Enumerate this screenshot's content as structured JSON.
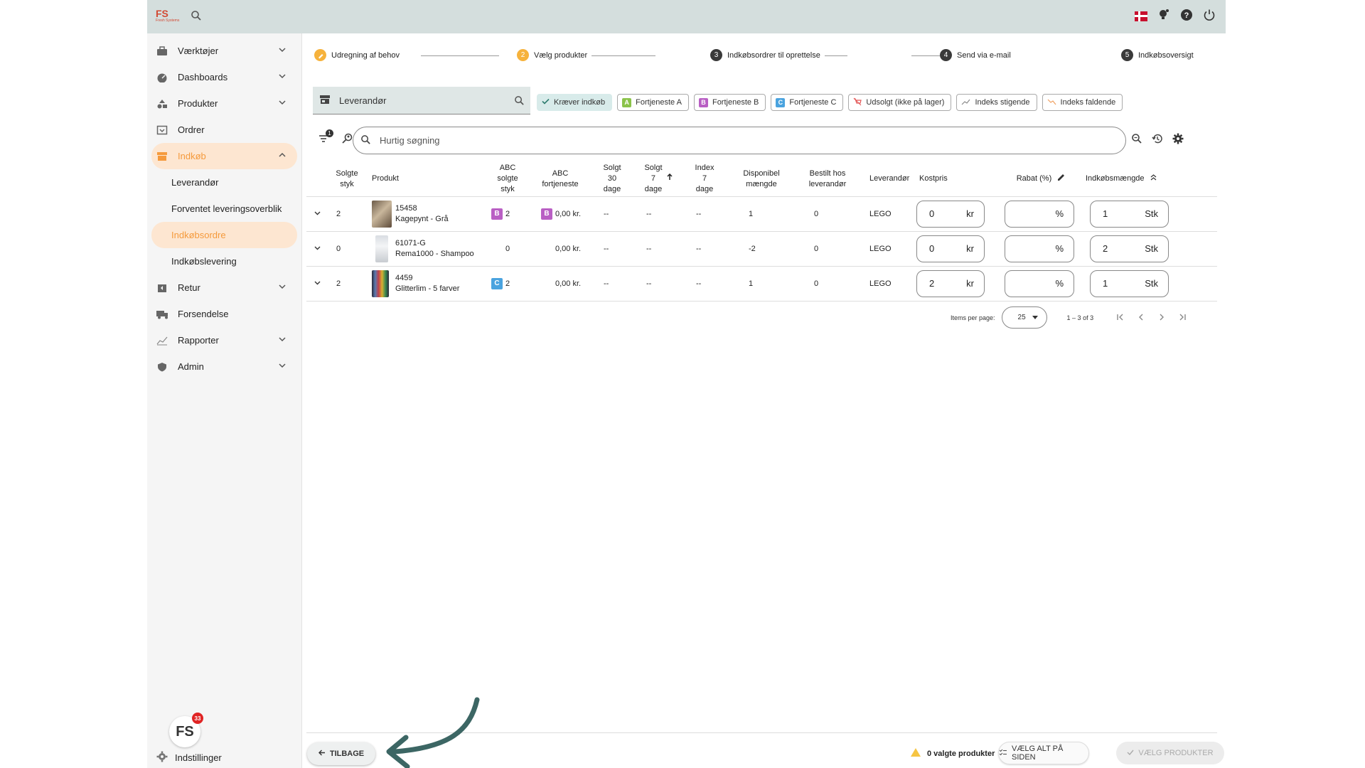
{
  "topbar": {
    "logo_mark": "FS",
    "logo_sub": "Fresh Systems",
    "icons": [
      "search-icon",
      "danish-flag-icon",
      "lightbulb-icon",
      "help-icon",
      "power-icon"
    ]
  },
  "sidebar": {
    "items": [
      {
        "label": "Værktøjer",
        "icon": "toolbox-icon",
        "chevron": "down"
      },
      {
        "label": "Dashboards",
        "icon": "dashboard-icon",
        "chevron": "down"
      },
      {
        "label": "Produkter",
        "icon": "shapes-icon",
        "chevron": "down"
      },
      {
        "label": "Ordrer",
        "icon": "order-icon"
      },
      {
        "label": "Indkøb",
        "icon": "store-icon",
        "chevron": "up",
        "active": true
      },
      {
        "label": "Retur",
        "icon": "return-icon",
        "chevron": "down"
      },
      {
        "label": "Forsendelse",
        "icon": "truck-icon"
      },
      {
        "label": "Rapporter",
        "icon": "chart-icon",
        "chevron": "down"
      },
      {
        "label": "Admin",
        "icon": "admin-icon",
        "chevron": "down"
      }
    ],
    "sub_items": [
      "Leverandør",
      "Forventet leveringsoverblik",
      "Indkøbsordre",
      "Indkøbslevering"
    ],
    "active_sub": "Indkøbsordre",
    "badge_count": "33",
    "settings_label": "Indstillinger",
    "logo_mark": "FS"
  },
  "stepper": {
    "steps": [
      {
        "n": "✓",
        "label": "Udregning af behov",
        "state": "done"
      },
      {
        "n": "2",
        "label": "Vælg produkter",
        "state": "current"
      },
      {
        "n": "3",
        "label": "Indkøbsordrer til oprettelse",
        "state": "todo"
      },
      {
        "n": "4",
        "label": "Send via e-mail",
        "state": "todo"
      },
      {
        "n": "5",
        "label": "Indkøbsoversigt",
        "state": "todo"
      }
    ]
  },
  "supplier": {
    "label": "Leverandør"
  },
  "chips": [
    {
      "label": "Kræver indkøb",
      "icon": "check-icon",
      "selected": true
    },
    {
      "label": "Fortjeneste A",
      "letter": "A",
      "color": "#8bc34a"
    },
    {
      "label": "Fortjeneste B",
      "letter": "B",
      "color": "#b95fc4"
    },
    {
      "label": "Fortjeneste C",
      "letter": "C",
      "color": "#4aa3df"
    },
    {
      "label": "Udsolgt (ikke på lager)",
      "icon": "cart-off-icon"
    },
    {
      "label": "Indeks stigende",
      "icon": "trend-up-icon"
    },
    {
      "label": "Indeks faldende",
      "icon": "trend-down-icon"
    }
  ],
  "filter_badge": "1",
  "search": {
    "placeholder": "Hurtig søgning"
  },
  "table": {
    "headers": [
      "Solgte\nstyk",
      "Produkt",
      "ABC\nsolgte\nstyk",
      "ABC\nfortjeneste",
      "Solgt\n30\ndage",
      "Solgt\n7\ndage",
      "Index\n7\ndage",
      "Disponibel\nmængde",
      "Bestilt hos\nleverandør",
      "Leverandør",
      "Kostpris",
      "Rabat (%)",
      "Indkøbsmængde"
    ],
    "rows": [
      {
        "sold": "2",
        "sku": "15458",
        "name": "Kagepynt - Grå",
        "abc_sold_badge": "B",
        "abc_sold_val": "2",
        "abc_profit_badge": "B",
        "abc_profit": "0,00 kr.",
        "s30": "--",
        "s7": "--",
        "idx7": "--",
        "avail": "1",
        "ordered": "0",
        "supplier": "LEGO",
        "cost": "0",
        "cost_unit": "kr",
        "discount": "",
        "disc_unit": "%",
        "qty": "1",
        "qty_unit": "Stk"
      },
      {
        "sold": "0",
        "sku": "61071-G",
        "name": "Rema1000 - Shampoo",
        "abc_sold_badge": "",
        "abc_sold_val": "0",
        "abc_profit_badge": "",
        "abc_profit": "0,00 kr.",
        "s30": "--",
        "s7": "--",
        "idx7": "--",
        "avail": "-2",
        "ordered": "0",
        "supplier": "LEGO",
        "cost": "0",
        "cost_unit": "kr",
        "discount": "",
        "disc_unit": "%",
        "qty": "2",
        "qty_unit": "Stk"
      },
      {
        "sold": "2",
        "sku": "4459",
        "name": "Glitterlim - 5 farver",
        "abc_sold_badge": "C",
        "abc_sold_val": "2",
        "abc_profit_badge": "",
        "abc_profit": "0,00 kr.",
        "s30": "--",
        "s7": "--",
        "idx7": "--",
        "avail": "1",
        "ordered": "0",
        "supplier": "LEGO",
        "cost": "2",
        "cost_unit": "kr",
        "discount": "",
        "disc_unit": "%",
        "qty": "1",
        "qty_unit": "Stk"
      }
    ]
  },
  "badge_colors": {
    "A": "#8bc34a",
    "B": "#b95fc4",
    "C": "#4aa3df"
  },
  "pagination": {
    "items_per_page_label": "Items per page:",
    "per_page": "25",
    "range": "1 – 3 of 3"
  },
  "footer": {
    "back_label": "TILBAGE",
    "selected_count": "0 valgte produkter",
    "select_all_label": "VÆLG ALT PÅ SIDEN",
    "choose_label": "VÆLG PRODUKTER"
  }
}
